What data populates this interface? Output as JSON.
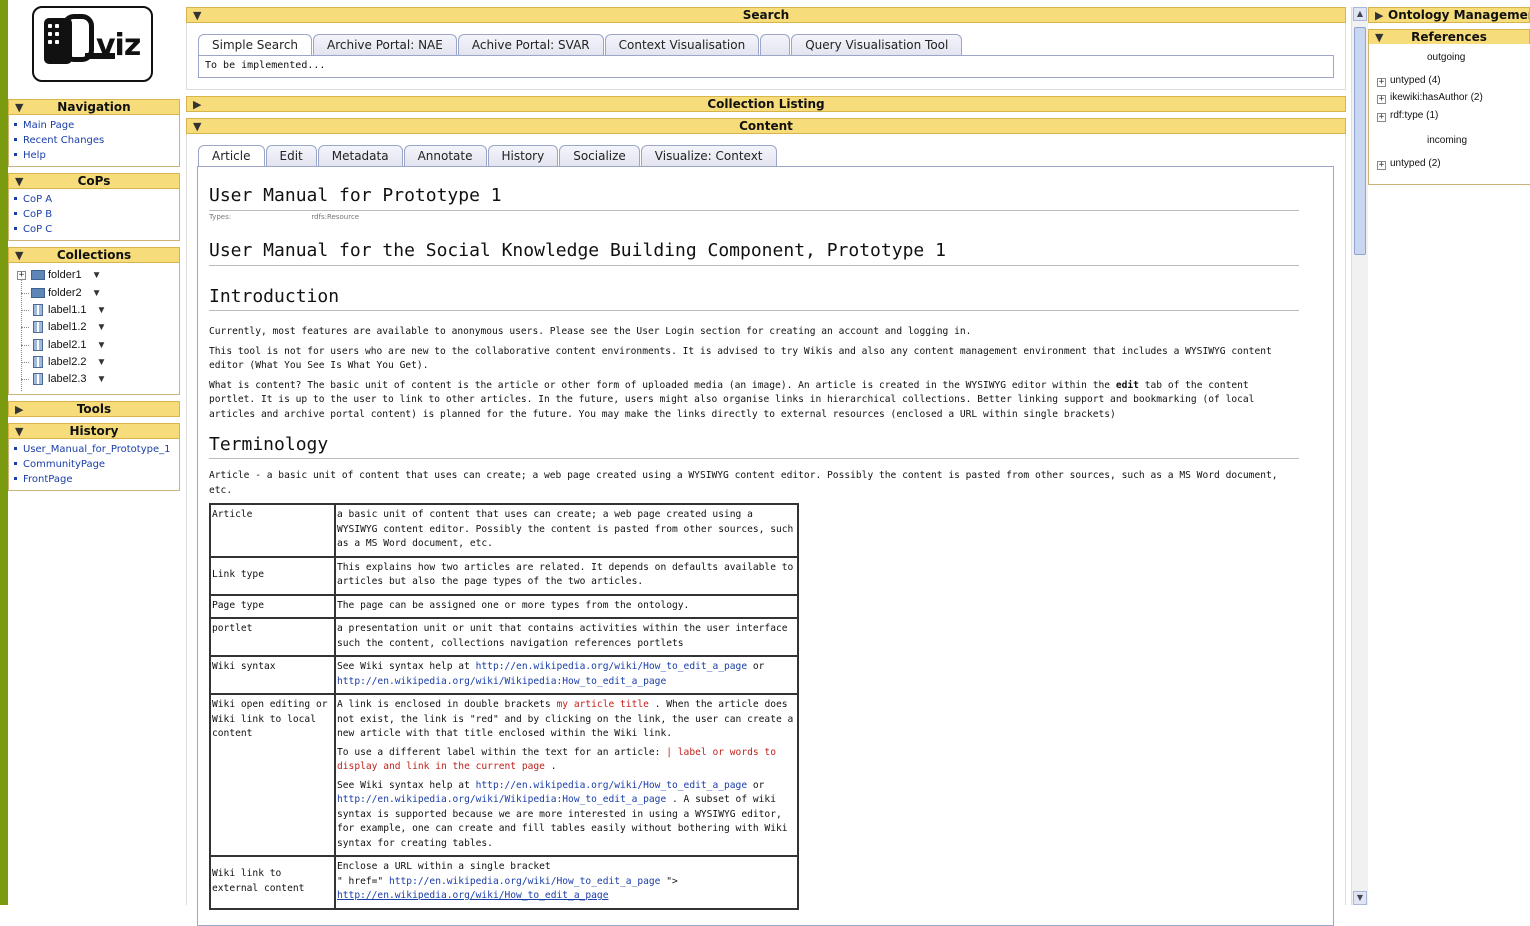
{
  "colors": {
    "header": "#f6dc7a",
    "link": "#1a3ea8",
    "wikilink": "#c0221c",
    "strip": "#7a9a10"
  },
  "logo": {
    "text": "viz"
  },
  "left": {
    "navigation": {
      "title": "Navigation",
      "items": [
        "Main Page",
        "Recent Changes",
        "Help"
      ]
    },
    "cops": {
      "title": "CoPs",
      "items": [
        "CoP A",
        "CoP B",
        "CoP C"
      ]
    },
    "collections": {
      "title": "Collections",
      "items": [
        "folder1",
        "folder2",
        "label1.1",
        "label1.2",
        "label2.1",
        "label2.2",
        "label2.3"
      ]
    },
    "tools": {
      "title": "Tools"
    },
    "history": {
      "title": "History",
      "items": [
        "User_Manual_for_Prototype_1",
        "CommunityPage",
        "FrontPage"
      ]
    }
  },
  "search": {
    "title": "Search",
    "tabs": [
      "Simple Search",
      "Archive Portal: NAE",
      "Achive Portal: SVAR",
      "Context Visualisation",
      "",
      "Query Visualisation Tool"
    ],
    "body": "To be implemented..."
  },
  "collection_listing": {
    "title": "Collection Listing"
  },
  "content": {
    "title": "Content",
    "tabs": [
      "Article",
      "Edit",
      "Metadata",
      "Annotate",
      "History",
      "Socialize",
      "Visualize: Context"
    ],
    "page_title": "User Manual for Prototype 1",
    "types_label": "Types:",
    "types_value": "rdfs:Resource",
    "h_main": "User Manual for the Social Knowledge Building Component, Prototype 1",
    "h_intro": "Introduction",
    "p1": "Currently, most features are available to anonymous users. Please see the User Login section for creating an account and logging in.",
    "p2": "This tool is not for users who are new to the collaborative content environments. It is advised to try Wikis and also any content management environment that includes a WYSIWYG content editor (What You See Is What You Get).",
    "p3a": "What is content? The basic unit of content is the article or other form of uploaded media (an image). An article is created in the WYSIWYG editor within the ",
    "p3b": "edit",
    "p3c": " tab of the content portlet. It is up to the user to link to other articles. In the future, users might also organise links in hierarchical collections. Better linking support and bookmarking (of local articles and archive portal content) is planned for the future. You may make the links directly to external resources (enclosed a URL within single brackets)",
    "h_term": "Terminology",
    "p4": "Article - a basic unit of content that uses can create; a web page created using a WYSIWYG content editor. Possibly the content is pasted from other sources, such as a MS Word document, etc.",
    "table": {
      "r1": {
        "term": "Article",
        "def": "a basic unit of content that uses can create; a web page created using a WYSIWYG content editor. Possibly the content is pasted from other sources, such as a MS Word document, etc."
      },
      "r2": {
        "term": "Link type",
        "def": "This explains how two articles are related. It depends on defaults available to articles but also the page types of the two articles."
      },
      "r3": {
        "term": "Page type",
        "def": "The page can be assigned one or more types from the ontology."
      },
      "r4": {
        "term": "portlet",
        "def": "a presentation unit or unit that contains activities within the user interface such the content, collections navigation references portlets"
      },
      "r5": {
        "term": "Wiki syntax",
        "pre": "See Wiki syntax help at ",
        "link1": "http://en.wikipedia.org/wiki/How_to_edit_a_page",
        "mid": " or ",
        "link2": "http://en.wikipedia.org/wiki/Wikipedia:How_to_edit_a_page"
      },
      "r6": {
        "term": "Wiki open editing or Wiki link to local content",
        "a1": "A link is enclosed in double brackets ",
        "a2": "my article title",
        "a3": " . When the article does not exist, the link is \"red\" and by clicking on the link, the user can create a new article with that title enclosed within the Wiki link.",
        "b1": "To use a different label within the text for an article: ",
        "b2": "| label or words to display and link in the current page",
        "b3": " .",
        "c1": "See Wiki syntax help at ",
        "c2": "http://en.wikipedia.org/wiki/How_to_edit_a_page",
        "c3": " or ",
        "c4": "http://en.wikipedia.org/wiki/Wikipedia:How_to_edit_a_page",
        "c5": " . A subset of wiki syntax is supported because we are more interested in using a WYSIWYG editor, for example, one can create and fill tables easily without bothering with Wiki syntax for creating tables."
      },
      "r7": {
        "term": "Wiki link to external content",
        "a1": "Enclose a URL within a single bracket",
        "b1": "\" href=\" ",
        "b2": "http://en.wikipedia.org/wiki/How_to_edit_a_page",
        "b3": " \">",
        "c1": "http://en.wikipedia.org/wiki/How_to_edit_a_page"
      }
    }
  },
  "right": {
    "ontology": {
      "title": "Ontology Management"
    },
    "references": {
      "title": "References",
      "outgoing": "outgoing",
      "incoming": "incoming",
      "out_items": [
        "untyped (4)",
        "ikewiki:hasAuthor (2)",
        "rdf:type (1)"
      ],
      "in_items": [
        "untyped (2)"
      ]
    }
  }
}
